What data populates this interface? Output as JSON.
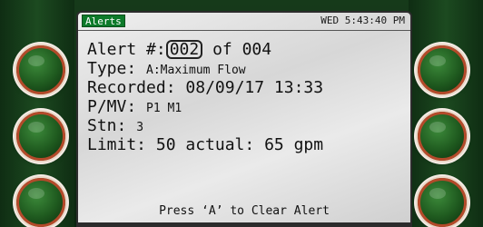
{
  "header": {
    "tab_label": "Alerts",
    "clock": "WED 5:43:40 PM"
  },
  "alert": {
    "number_label": "Alert #:",
    "number": "002",
    "of_label": "of",
    "total": "004",
    "type_label": "Type:",
    "type_value": "A:Maximum Flow",
    "recorded_label": "Recorded:",
    "recorded_value": "08/09/17 13:33",
    "pmv_label": "P/MV:",
    "pmv_value": "P1 M1",
    "stn_label": "Stn:",
    "stn_value": "3",
    "limit_line": "Limit: 50 actual: 65 gpm"
  },
  "footer": {
    "hint": "Press ‘A’ to Clear Alert"
  },
  "colors": {
    "bezel": "#0e2a12",
    "tab_green": "#0d7a2a",
    "key_ring": "#b44a2a"
  },
  "softkeys": {
    "left": [
      "softkey-left-1",
      "softkey-left-2",
      "softkey-left-3"
    ],
    "right": [
      "softkey-right-1",
      "softkey-right-2",
      "softkey-right-3"
    ]
  }
}
